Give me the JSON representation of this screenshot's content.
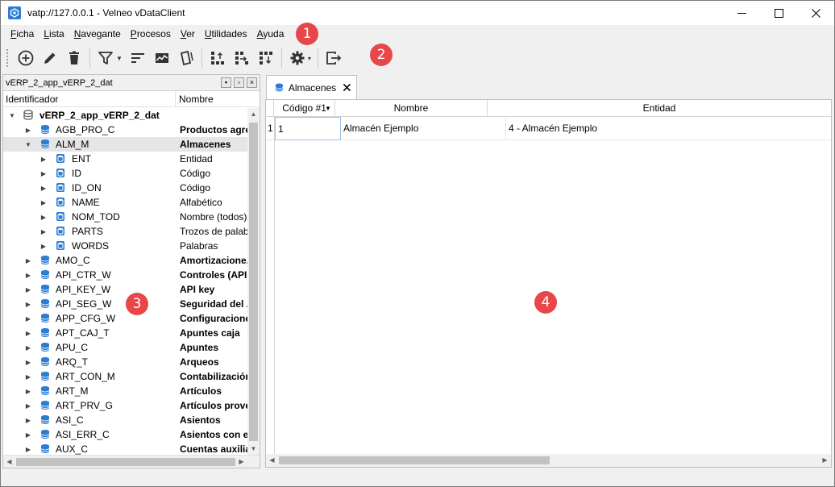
{
  "window": {
    "title": "vatp://127.0.0.1 - Velneo vDataClient",
    "accent": "#2b7cd3"
  },
  "menu": {
    "items": [
      {
        "label": "Ficha",
        "mnemonic": "F",
        "rest": "icha"
      },
      {
        "label": "Lista",
        "mnemonic": "L",
        "rest": "ista"
      },
      {
        "label": "Navegante",
        "mnemonic": "N",
        "rest": "avegante"
      },
      {
        "label": "Procesos",
        "mnemonic": "P",
        "rest": "rocesos"
      },
      {
        "label": "Ver",
        "mnemonic": "V",
        "rest": "er"
      },
      {
        "label": "Utilidades",
        "mnemonic": "U",
        "rest": "tilidades"
      },
      {
        "label": "Ayuda",
        "mnemonic": "A",
        "rest": "yuda"
      }
    ]
  },
  "toolbar": {
    "icons": [
      "add-circle-icon",
      "edit-pencil-icon",
      "delete-trash-icon",
      "filter-icon",
      "sort-icon",
      "chart-icon",
      "label-icon",
      "grid-up-icon",
      "grid-right-icon",
      "grid-down-icon",
      "settings-gear-icon",
      "exit-icon"
    ]
  },
  "badges": [
    "1",
    "2",
    "3",
    "4"
  ],
  "badge_color": "#e8474a",
  "left_panel": {
    "title": "vERP_2_app_vERP_2_dat",
    "col_identifier": "Identificador",
    "col_name": "Nombre",
    "root": "vERP_2_app_vERP_2_dat",
    "rows": [
      {
        "id": "AGB_PRO_C",
        "name": "Productos agre...",
        "level": 1,
        "expanded": false
      },
      {
        "id": "ALM_M",
        "name": "Almacenes",
        "level": 1,
        "expanded": true
      },
      {
        "id": "ENT",
        "name": "Entidad",
        "level": 2,
        "expanded": false
      },
      {
        "id": "ID",
        "name": "Código",
        "level": 2,
        "expanded": false
      },
      {
        "id": "ID_ON",
        "name": "Código",
        "level": 2,
        "expanded": false
      },
      {
        "id": "NAME",
        "name": "Alfabético",
        "level": 2,
        "expanded": false
      },
      {
        "id": "NOM_TOD",
        "name": "Nombre (todos)",
        "level": 2,
        "expanded": false
      },
      {
        "id": "PARTS",
        "name": "Trozos de palab...",
        "level": 2,
        "expanded": false
      },
      {
        "id": "WORDS",
        "name": "Palabras",
        "level": 2,
        "expanded": false
      },
      {
        "id": "AMO_C",
        "name": "Amortizacione...",
        "level": 1,
        "expanded": false
      },
      {
        "id": "API_CTR_W",
        "name": "Controles (API ...",
        "level": 1,
        "expanded": false
      },
      {
        "id": "API_KEY_W",
        "name": "API key",
        "level": 1,
        "expanded": false
      },
      {
        "id": "API_SEG_W",
        "name": "Seguridad del ...",
        "level": 1,
        "expanded": false
      },
      {
        "id": "APP_CFG_W",
        "name": "Configuracione...",
        "level": 1,
        "expanded": false
      },
      {
        "id": "APT_CAJ_T",
        "name": "Apuntes caja",
        "level": 1,
        "expanded": false
      },
      {
        "id": "APU_C",
        "name": "Apuntes",
        "level": 1,
        "expanded": false
      },
      {
        "id": "ARQ_T",
        "name": "Arqueos",
        "level": 1,
        "expanded": false
      },
      {
        "id": "ART_CON_M",
        "name": "Contabilización...",
        "level": 1,
        "expanded": false
      },
      {
        "id": "ART_M",
        "name": "Artículos",
        "level": 1,
        "expanded": false
      },
      {
        "id": "ART_PRV_G",
        "name": "Artículos prove...",
        "level": 1,
        "expanded": false
      },
      {
        "id": "ASI_C",
        "name": "Asientos",
        "level": 1,
        "expanded": false
      },
      {
        "id": "ASI_ERR_C",
        "name": "Asientos con er...",
        "level": 1,
        "expanded": false
      },
      {
        "id": "AUX_C",
        "name": "Cuentas auxilia...",
        "level": 1,
        "expanded": false
      }
    ]
  },
  "tab": {
    "label": "Almacenes"
  },
  "grid": {
    "columns": [
      "Código #1",
      "Nombre",
      "Entidad"
    ],
    "rows": [
      {
        "num": "1",
        "codigo": "1",
        "nombre": "Almacén Ejemplo",
        "entidad": "4 - Almacén Ejemplo"
      }
    ]
  }
}
